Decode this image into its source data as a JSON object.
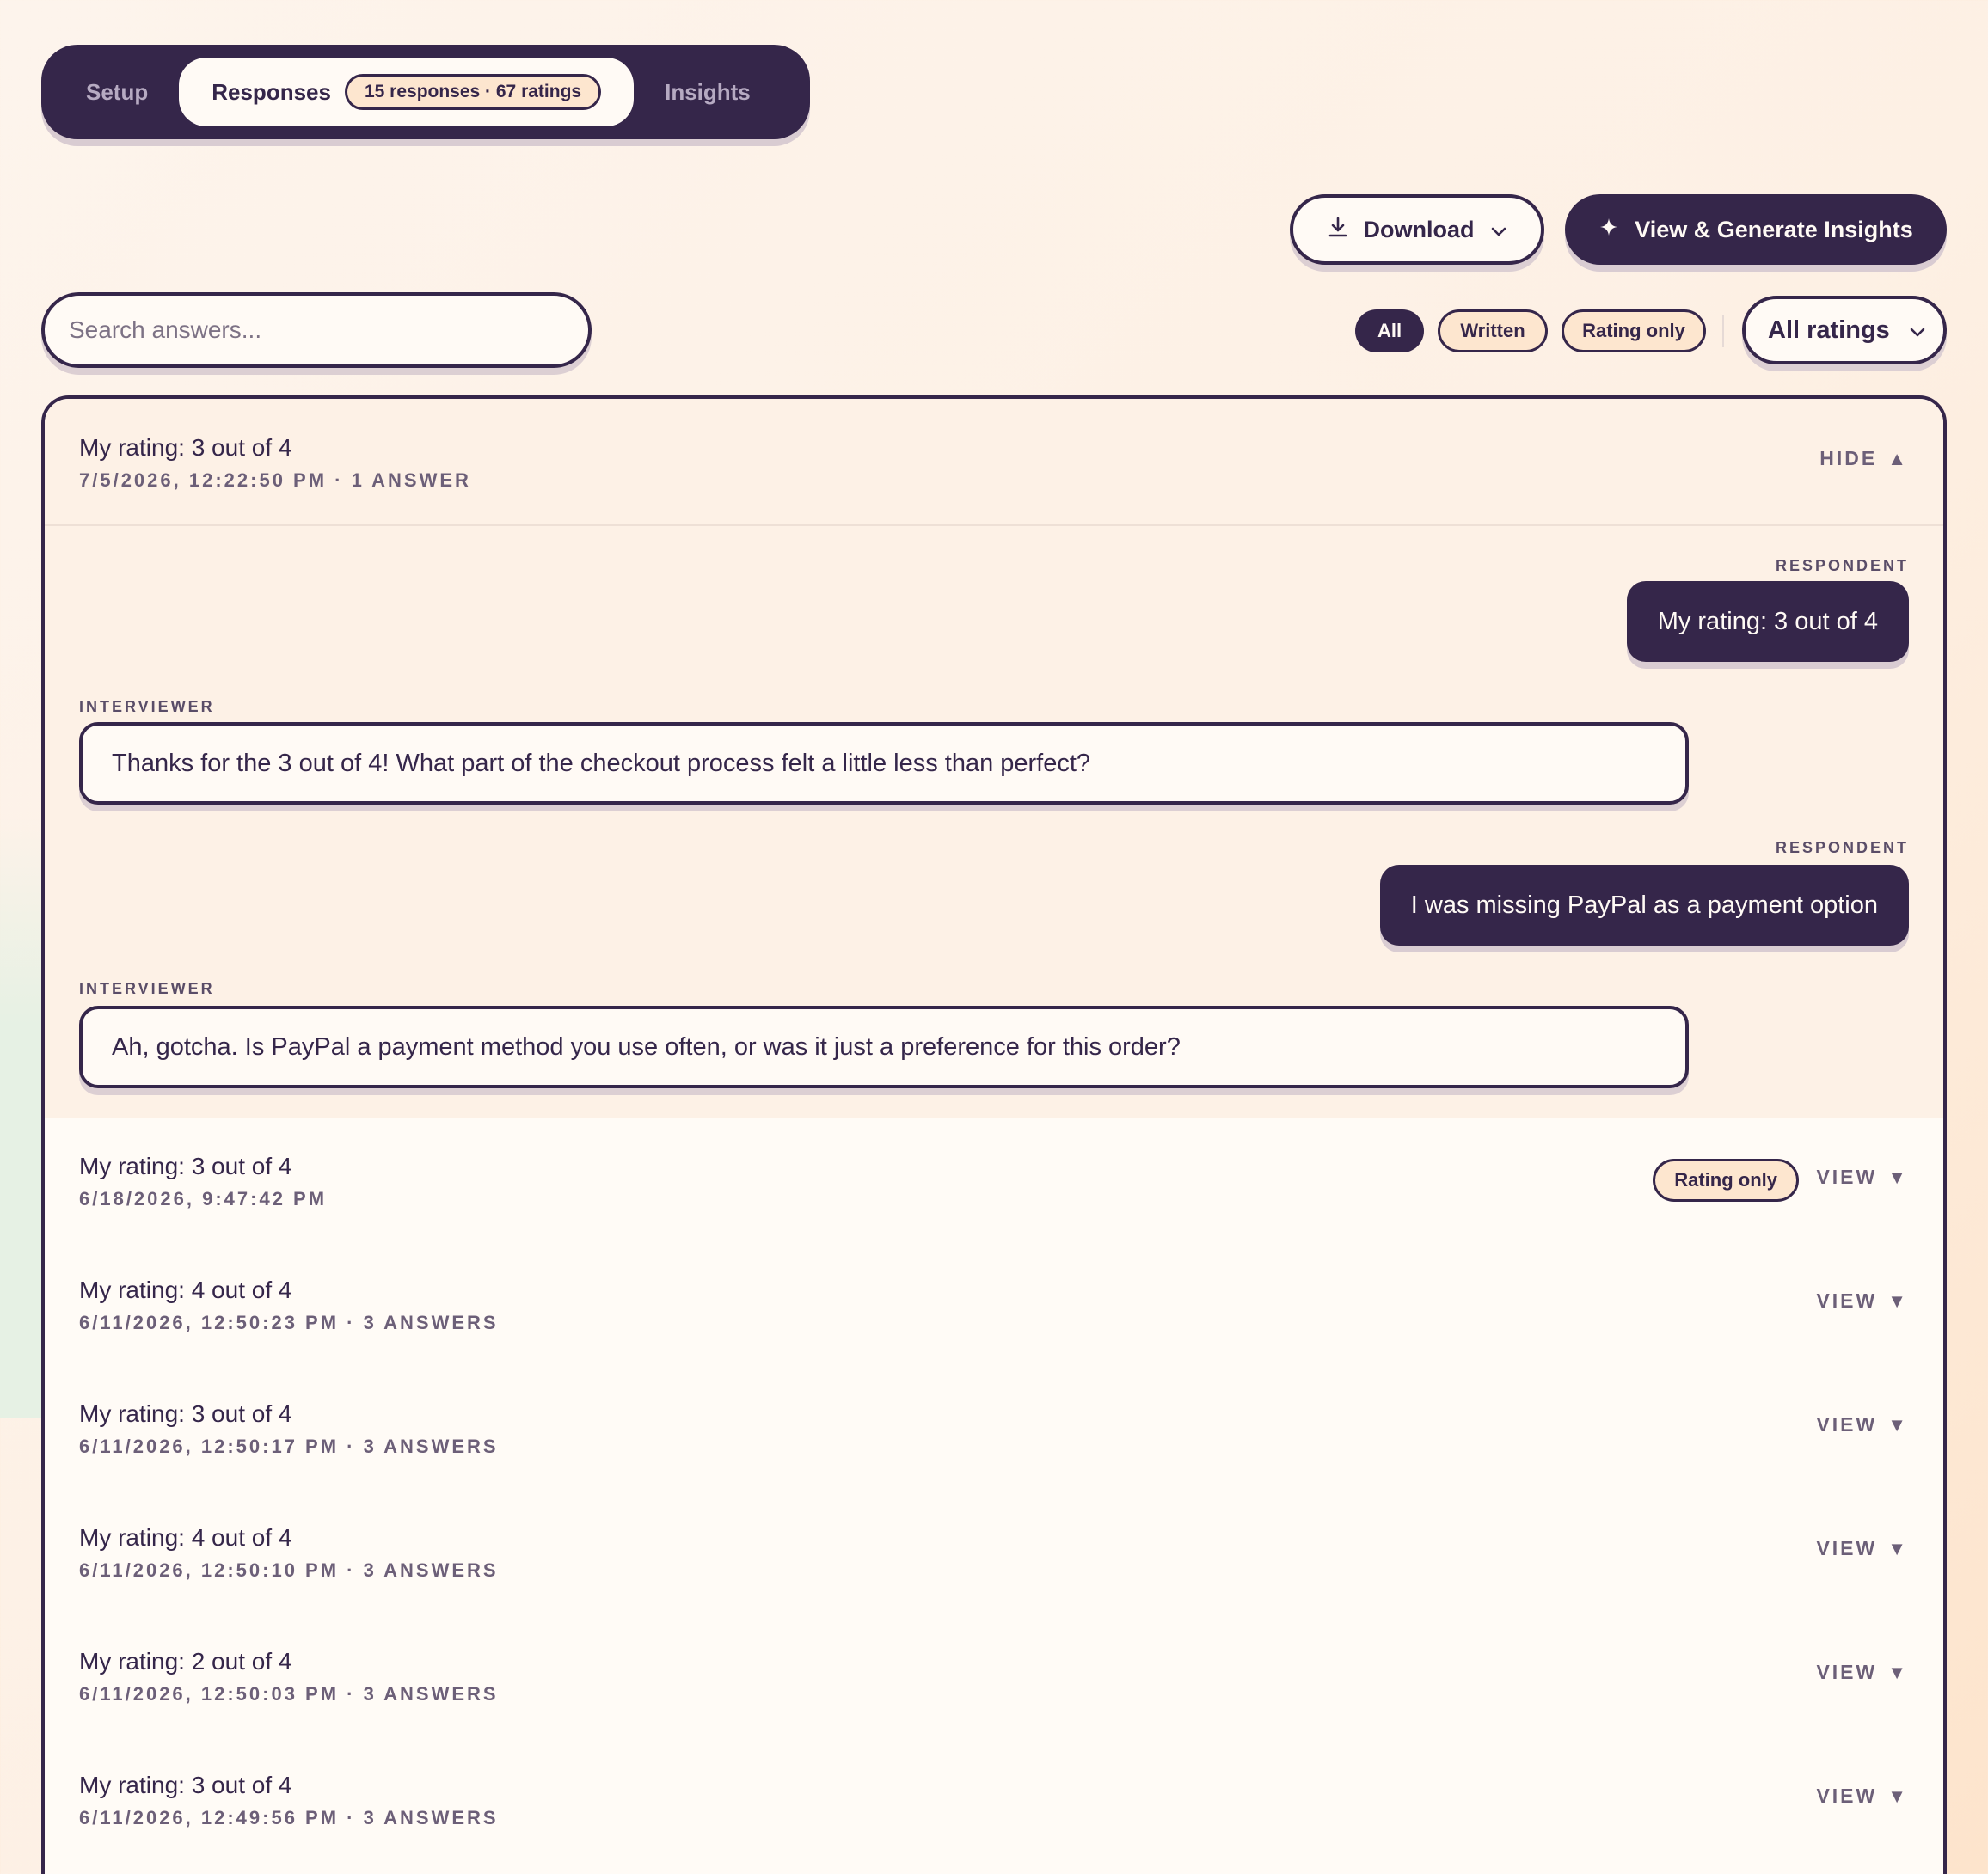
{
  "tabs": {
    "setup": "Setup",
    "responses": "Responses",
    "responses_count": "15 responses · 67 ratings",
    "insights": "Insights"
  },
  "actions": {
    "download": "Download",
    "insights": "View & Generate Insights"
  },
  "search": {
    "placeholder": "Search answers..."
  },
  "filters": {
    "all": "All",
    "written": "Written",
    "rating_only": "Rating only",
    "ratings_select": "All ratings"
  },
  "roles": {
    "respondent": "RESPONDENT",
    "interviewer": "INTERVIEWER"
  },
  "expanded": {
    "title": "My rating: 3 out of 4",
    "meta": "7/5/2026, 12:22:50 PM · 1 ANSWER",
    "toggle": "HIDE",
    "messages": [
      {
        "role": "respondent",
        "text": "My rating: 3 out of 4"
      },
      {
        "role": "interviewer",
        "text": "Thanks for the 3 out of 4! What part of the checkout process felt a little less than perfect?"
      },
      {
        "role": "respondent",
        "text": "I was missing PayPal as a payment option"
      },
      {
        "role": "interviewer",
        "text": "Ah, gotcha. Is PayPal a payment method you use often, or was it just a preference for this order?"
      }
    ]
  },
  "view_label": "VIEW",
  "rows": [
    {
      "title": "My rating: 3 out of 4",
      "meta": "6/18/2026, 9:47:42 PM",
      "badge": "Rating only"
    },
    {
      "title": "My rating: 4 out of 4",
      "meta": "6/11/2026, 12:50:23 PM · 3 ANSWERS"
    },
    {
      "title": "My rating: 3 out of 4",
      "meta": "6/11/2026, 12:50:17 PM · 3 ANSWERS"
    },
    {
      "title": "My rating: 4 out of 4",
      "meta": "6/11/2026, 12:50:10 PM · 3 ANSWERS"
    },
    {
      "title": "My rating: 2 out of 4",
      "meta": "6/11/2026, 12:50:03 PM · 3 ANSWERS"
    },
    {
      "title": "My rating: 3 out of 4",
      "meta": "6/11/2026, 12:49:56 PM · 3 ANSWERS"
    }
  ],
  "icons": {
    "download": "download-icon",
    "sparkle": "sparkle-icon",
    "chevron": "chevron-down-icon"
  },
  "colors": {
    "primary": "#35264a",
    "accent_chip": "#fde6cf",
    "surface": "#fffaf5"
  }
}
